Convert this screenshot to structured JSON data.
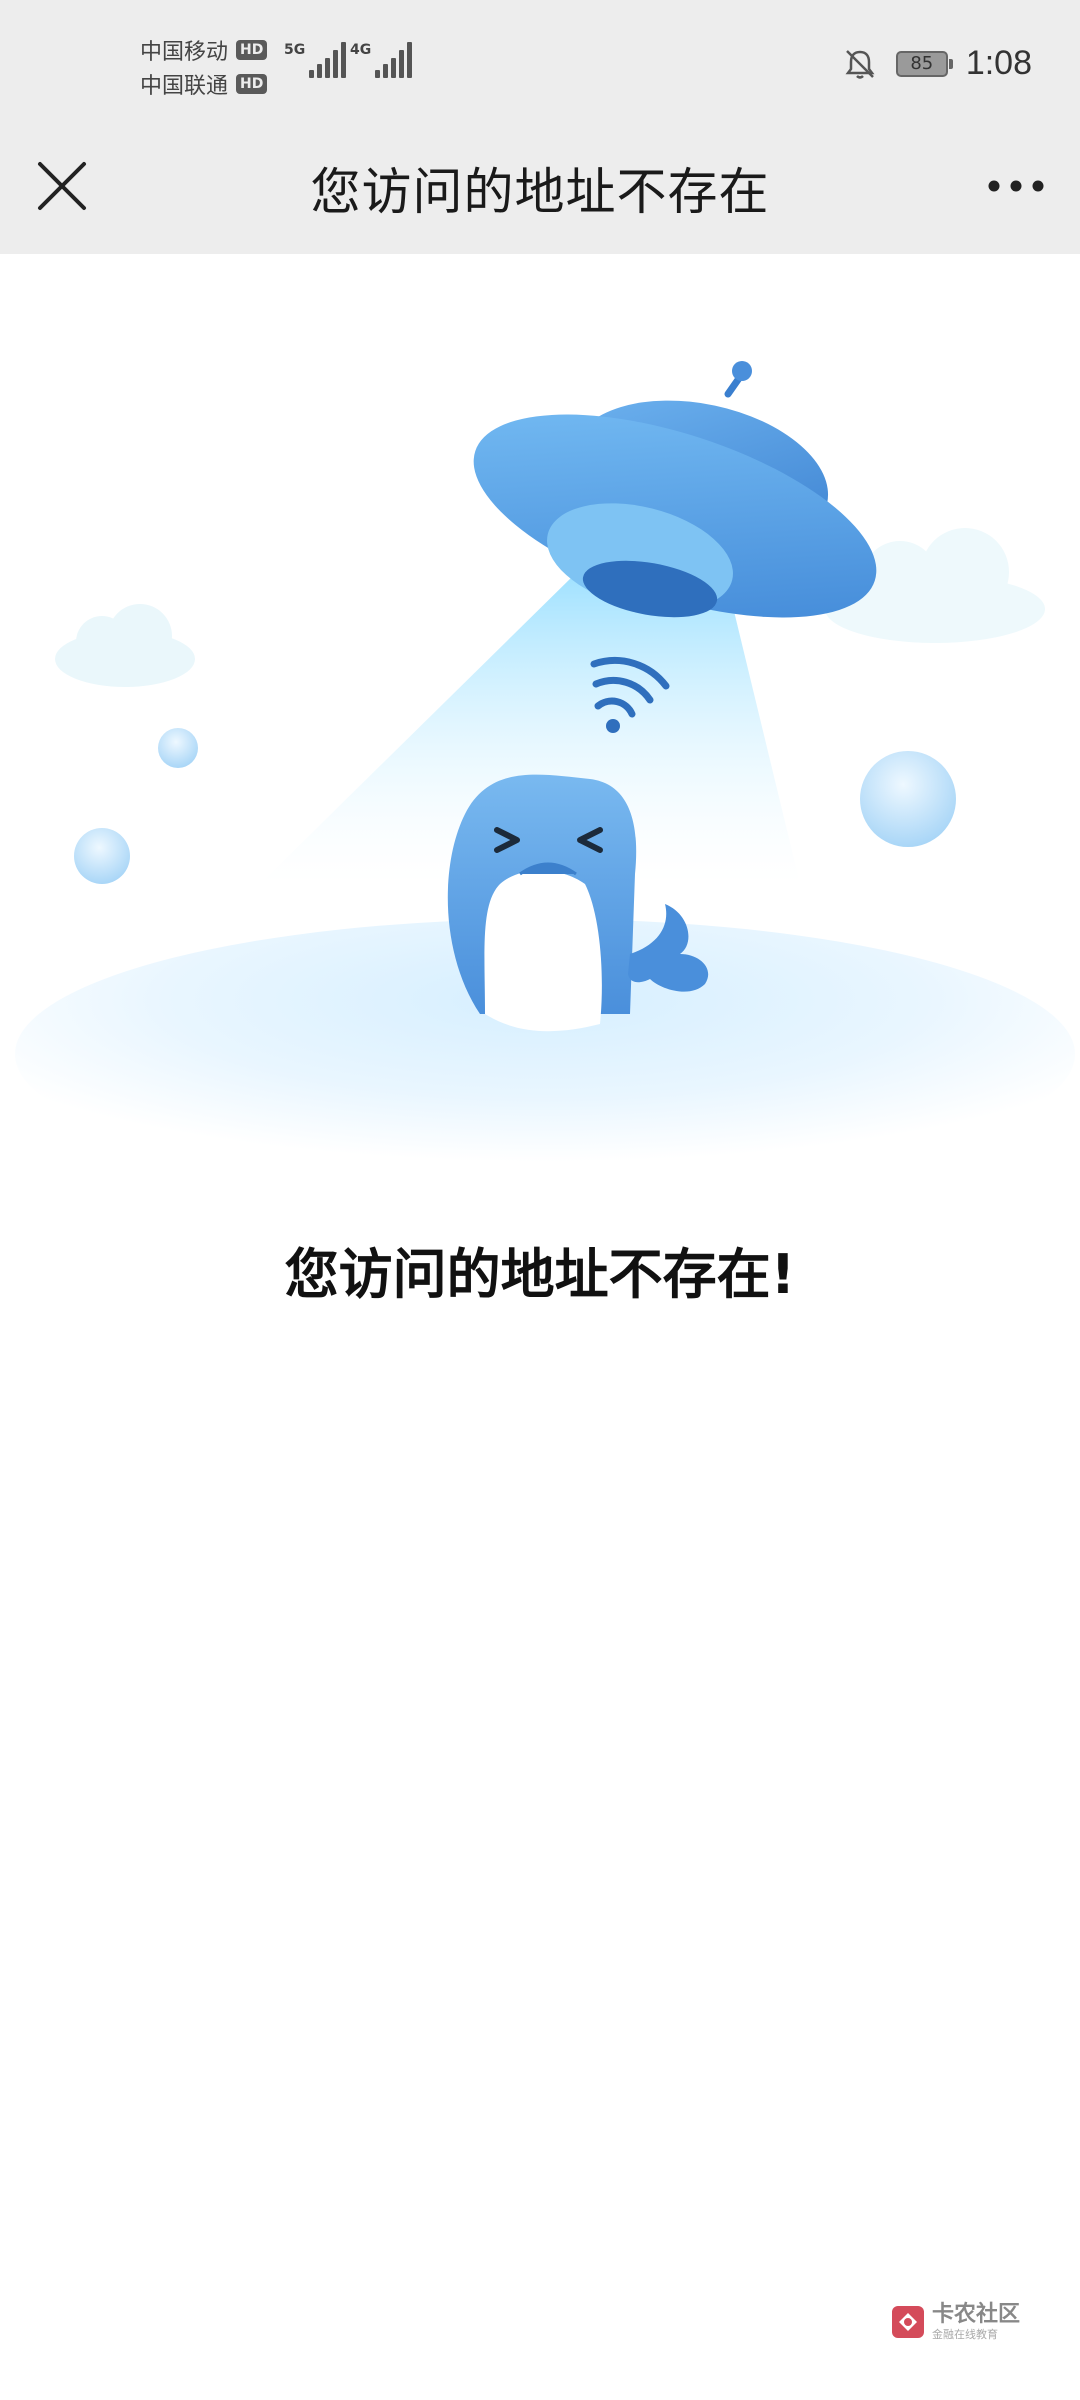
{
  "status_bar": {
    "carrier1": "中国移动",
    "carrier2": "中国联通",
    "hd": "HD",
    "network1": "5G",
    "network2": "4G",
    "battery_level": "85",
    "time": "1:08"
  },
  "nav": {
    "title": "您访问的地址不存在"
  },
  "page": {
    "error_message": "您访问的地址不存在!"
  },
  "watermark": {
    "title": "卡农社区",
    "subtitle": "金融在线教育"
  },
  "colors": {
    "bar_background": "#ededed",
    "ufo_blue": "#4a8fdb",
    "whale_blue": "#5aa0e6",
    "beam": "#bfe9ff"
  }
}
